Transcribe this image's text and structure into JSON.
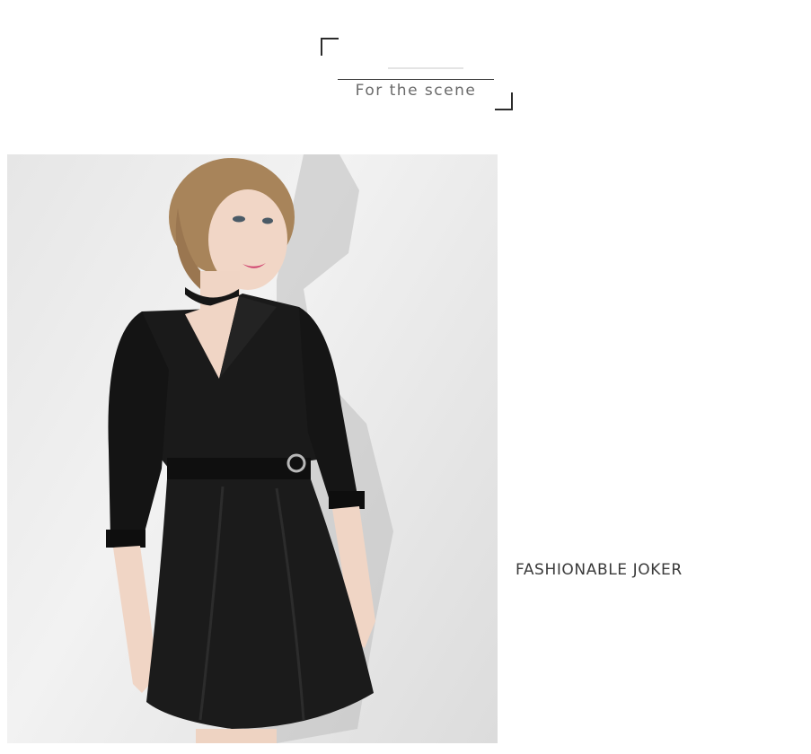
{
  "header": {
    "title": "For the scene"
  },
  "photo": {
    "subject": "woman-in-black-wrap-dress"
  },
  "tagline": "FASHIONABLE JOKER"
}
